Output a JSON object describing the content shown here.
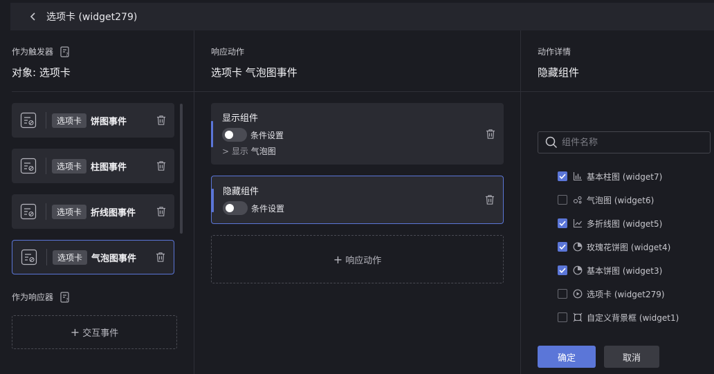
{
  "header": {
    "title": "选项卡 (widget279)"
  },
  "trigger": {
    "section_label": "作为触发器",
    "object_title": "对象: 选项卡",
    "events": [
      {
        "tag": "选项卡",
        "name": "饼图事件",
        "selected": false
      },
      {
        "tag": "选项卡",
        "name": "柱图事件",
        "selected": false
      },
      {
        "tag": "选项卡",
        "name": "折线图事件",
        "selected": false
      },
      {
        "tag": "选项卡",
        "name": "气泡图事件",
        "selected": true
      }
    ],
    "responder_label": "作为响应器",
    "add_interaction_label": "交互事件"
  },
  "response": {
    "section_label": "响应动作",
    "title": "选项卡 气泡图事件",
    "actions": [
      {
        "title": "显示组件",
        "toggle_label": "条件设置",
        "sub_prefix": "> 显示",
        "sub_target": "气泡图"
      },
      {
        "title": "隐藏组件",
        "toggle_label": "条件设置"
      }
    ],
    "add_action_label": "响应动作"
  },
  "details": {
    "section_label": "动作详情",
    "title": "隐藏组件",
    "search": {
      "placeholder": "组件名称",
      "value": ""
    },
    "components": [
      {
        "label": "基本柱图 (widget7)",
        "checked": true,
        "icon": "bar-chart-icon"
      },
      {
        "label": "气泡图 (widget6)",
        "checked": false,
        "icon": "bubble-chart-icon"
      },
      {
        "label": "多折线图 (widget5)",
        "checked": true,
        "icon": "line-chart-icon"
      },
      {
        "label": "玫瑰花饼图 (widget4)",
        "checked": true,
        "icon": "pie-chart-icon"
      },
      {
        "label": "基本饼图 (widget3)",
        "checked": true,
        "icon": "pie-chart-icon"
      },
      {
        "label": "选项卡 (widget279)",
        "checked": false,
        "icon": "tab-icon"
      },
      {
        "label": "自定义背景框 (widget1)",
        "checked": false,
        "icon": "frame-icon"
      }
    ],
    "ok_label": "确定",
    "cancel_label": "取消"
  },
  "colors": {
    "accent": "#5b76d8",
    "background": "#1b1c22",
    "card": "#2a2b32"
  }
}
